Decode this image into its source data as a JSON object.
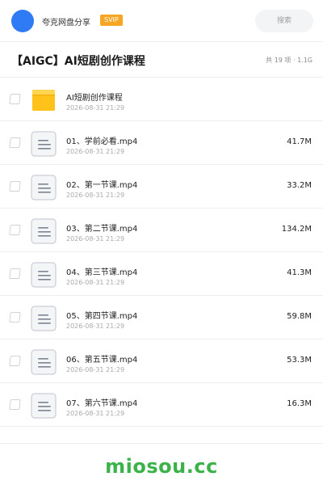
{
  "header": {
    "brand": "夸克网盘分享",
    "badge": "SVIP",
    "search_placeholder": "搜索"
  },
  "folder": {
    "title": "【AIGC】AI短剧创作课程",
    "summary": "共 19 项 · 1.1G"
  },
  "files": [
    {
      "type": "folder",
      "name": "AI短剧创作课程",
      "date": "2026-08-31 21:29",
      "size": ""
    },
    {
      "type": "file",
      "name": "01、学前必看.mp4",
      "date": "2026-08-31 21:29",
      "size": "41.7M"
    },
    {
      "type": "file",
      "name": "02、第一节课.mp4",
      "date": "2026-08-31 21:29",
      "size": "33.2M"
    },
    {
      "type": "file",
      "name": "03、第二节课.mp4",
      "date": "2026-08-31 21:29",
      "size": "134.2M"
    },
    {
      "type": "file",
      "name": "04、第三节课.mp4",
      "date": "2026-08-31 21:29",
      "size": "41.3M"
    },
    {
      "type": "file",
      "name": "05、第四节课.mp4",
      "date": "2026-08-31 21:29",
      "size": "59.8M"
    },
    {
      "type": "file",
      "name": "06、第五节课.mp4",
      "date": "2026-08-31 21:29",
      "size": "53.3M"
    },
    {
      "type": "file",
      "name": "07、第六节课.mp4",
      "date": "2026-08-31 21:29",
      "size": "16.3M"
    }
  ],
  "watermark": "miosou.cc",
  "colors": {
    "avatar": "#2f7bf6",
    "badge": "#f5a623",
    "folder": "#ffc21a",
    "watermark": "#3cb34a"
  },
  "icons": {
    "folder": "folder-icon",
    "file": "document-icon"
  }
}
